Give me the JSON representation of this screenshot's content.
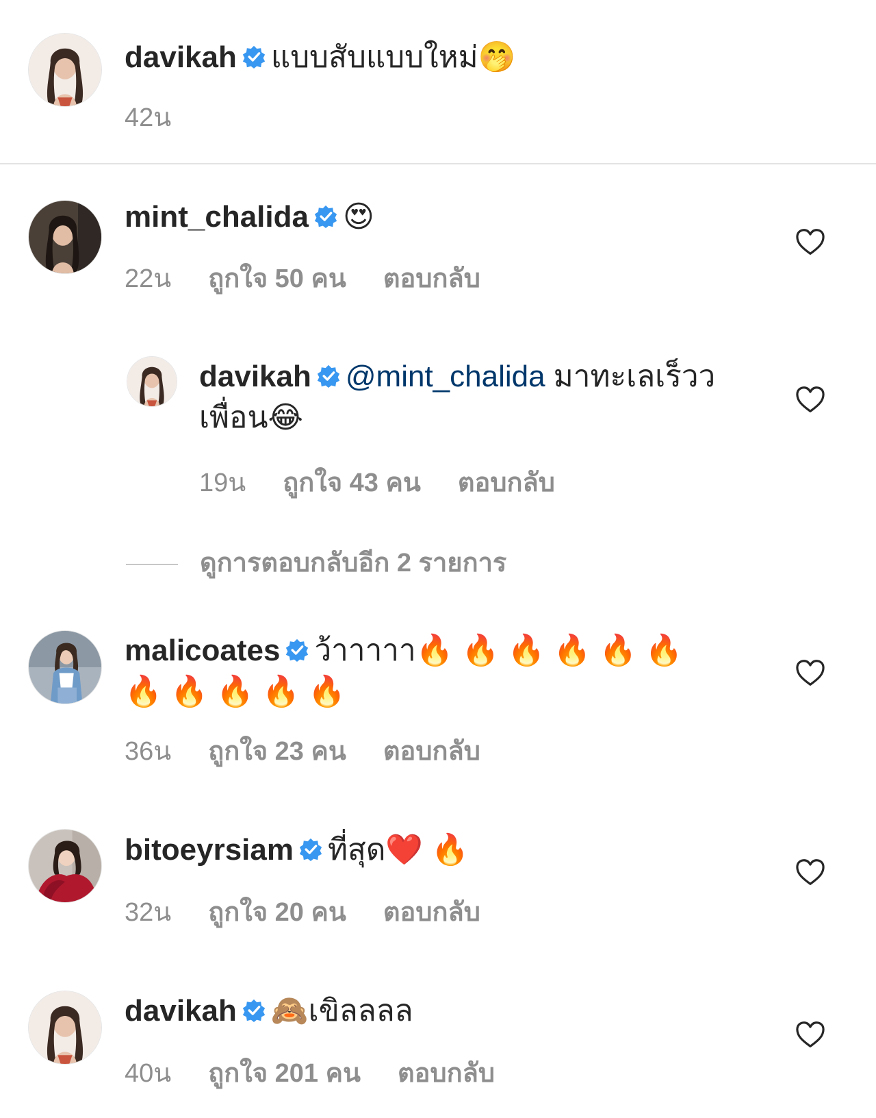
{
  "caption": {
    "username": "davikah",
    "text": "แบบสับแบบใหม่",
    "emoji": "🤭",
    "time": "42น"
  },
  "comments": [
    {
      "username": "mint_chalida",
      "text": "",
      "emoji": "😍",
      "time": "22น",
      "likes": "ถูกใจ 50 คน",
      "reply": "ตอบกลับ"
    },
    {
      "username": "davikah",
      "mention": "@mint_chalida",
      "text": " มาทะเลเร็ววเพื่อน",
      "emoji": "😂",
      "time": "19น",
      "likes": "ถูกใจ 43 คน",
      "reply": "ตอบกลับ"
    },
    {
      "username": "malicoates",
      "text": "ว้าาาาา",
      "emoji": "🔥 🔥 🔥 🔥 🔥 🔥 🔥 🔥 🔥 🔥 🔥",
      "time": "36น",
      "likes": "ถูกใจ 23 คน",
      "reply": "ตอบกลับ"
    },
    {
      "username": "bitoeyrsiam",
      "text": "ที่สุด",
      "emoji": "❤️ 🔥",
      "time": "32น",
      "likes": "ถูกใจ 20 คน",
      "reply": "ตอบกลับ"
    },
    {
      "username": "davikah",
      "text": "เขิลลลล",
      "emoji": "🙈",
      "time": "40น",
      "likes": "ถูกใจ 201 คน",
      "reply": "ตอบกลับ"
    }
  ],
  "more_replies": "ดูการตอบกลับอีก 2 รายการ",
  "colors": {
    "text": "#262626",
    "meta": "#8e8e8e",
    "verified": "#3897f0",
    "mention": "#00376b",
    "divider": "#e3e3e3"
  },
  "icons": {
    "verified": "verified-badge-icon",
    "like": "heart-outline-icon"
  }
}
